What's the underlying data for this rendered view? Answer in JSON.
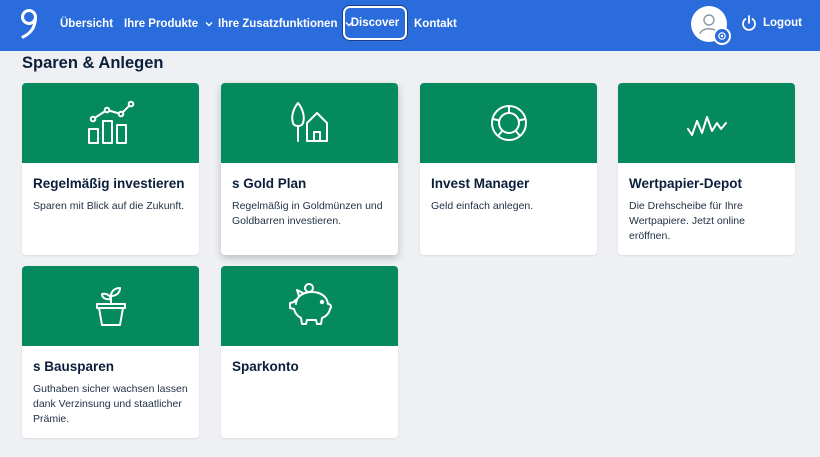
{
  "nav": {
    "items": [
      {
        "label": "Übersicht"
      },
      {
        "label": "Ihre Produkte"
      },
      {
        "label": "Ihre Zusatzfunktionen"
      },
      {
        "label": "Discover"
      },
      {
        "label": "Kontakt"
      }
    ],
    "logout_label": "Logout"
  },
  "section": {
    "title": "Sparen & Anlegen"
  },
  "cards": [
    {
      "title": "Regelmäßig investieren",
      "description": "Sparen mit Blick auf die Zukunft.",
      "icon": "bar-chart-trend-icon"
    },
    {
      "title": "s Gold Plan",
      "description": "Regelmäßig in Goldmünzen und Goldbarren investieren.",
      "icon": "tree-house-icon"
    },
    {
      "title": "Invest Manager",
      "description": "Geld einfach anlegen.",
      "icon": "donut-ring-icon"
    },
    {
      "title": "Wertpapier-Depot",
      "description": "Die Drehscheibe für Ihre Wertpapiere. Jetzt online eröffnen.",
      "icon": "zigzag-line-icon"
    },
    {
      "title": "s Bausparen",
      "description": "Guthaben sicher wachsen lassen dank Verzinsung und staatlicher Prämie.",
      "icon": "plant-pot-icon"
    },
    {
      "title": "Sparkonto",
      "description": "",
      "icon": "piggy-bank-icon"
    }
  ],
  "colors": {
    "header": "#2a6cdc",
    "card_banner": "#058a5e",
    "page_bg": "#eef0f3",
    "text": "#0b1f3a"
  }
}
